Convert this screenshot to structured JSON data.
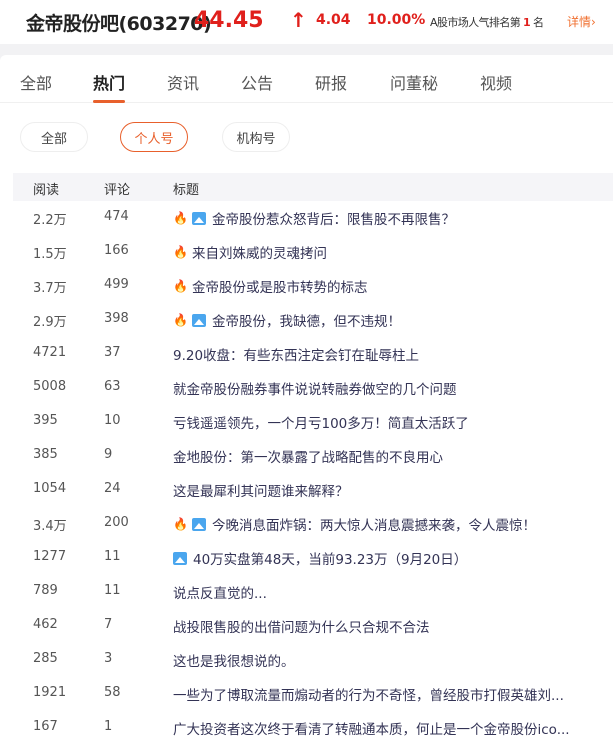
{
  "header": {
    "name": "金帝股份吧(603270)",
    "price": "44.45",
    "arrow": "↑",
    "change": "4.04",
    "percent": "10.00%",
    "rank_prefix": "A股市场人气排名第",
    "rank": "1",
    "rank_suffix": "名",
    "detail": "详情›"
  },
  "tabs": [
    "全部",
    "热门",
    "资讯",
    "公告",
    "研报",
    "问董秘",
    "视频"
  ],
  "filters": [
    "全部",
    "个人号",
    "机构号"
  ],
  "columns": [
    "阅读",
    "评论",
    "标题"
  ],
  "rows": [
    {
      "read": "2.2万",
      "comments": "474",
      "hot": true,
      "img": true,
      "title": "金帝股份惹众怒背后：限售股不再限售？"
    },
    {
      "read": "1.5万",
      "comments": "166",
      "hot": true,
      "img": false,
      "title": "来自刘姝威的灵魂拷问"
    },
    {
      "read": "3.7万",
      "comments": "499",
      "hot": true,
      "img": false,
      "title": "金帝股份或是股市转势的标志"
    },
    {
      "read": "2.9万",
      "comments": "398",
      "hot": true,
      "img": true,
      "title": "金帝股份，我缺德，但不违规！"
    },
    {
      "read": "4721",
      "comments": "37",
      "hot": false,
      "img": false,
      "title": "9.20收盘：有些东西注定会钉在耻辱柱上"
    },
    {
      "read": "5008",
      "comments": "63",
      "hot": false,
      "img": false,
      "title": "就金帝股份融券事件说说转融券做空的几个问题"
    },
    {
      "read": "395",
      "comments": "10",
      "hot": false,
      "img": false,
      "title": "亏钱遥遥领先，一个月亏100多万！简直太活跃了"
    },
    {
      "read": "385",
      "comments": "9",
      "hot": false,
      "img": false,
      "title": "金地股份：第一次暴露了战略配售的不良用心"
    },
    {
      "read": "1054",
      "comments": "24",
      "hot": false,
      "img": false,
      "title": "这是最犀利其问题谁来解释？"
    },
    {
      "read": "3.4万",
      "comments": "200",
      "hot": true,
      "img": true,
      "title": "今晚消息面炸锅：两大惊人消息震撼来袭，令人震惊！"
    },
    {
      "read": "1277",
      "comments": "11",
      "hot": false,
      "img": true,
      "title": "40万实盘第48天，当前93.23万（9月20日）"
    },
    {
      "read": "789",
      "comments": "11",
      "hot": false,
      "img": false,
      "title": "说点反直觉的..."
    },
    {
      "read": "462",
      "comments": "7",
      "hot": false,
      "img": false,
      "title": "战投限售股的出借问题为什么只合规不合法"
    },
    {
      "read": "285",
      "comments": "3",
      "hot": false,
      "img": false,
      "title": "这也是我很想说的。"
    },
    {
      "read": "1921",
      "comments": "58",
      "hot": false,
      "img": false,
      "title": "一些为了博取流量而煽动者的行为不奇怪，曾经股市打假英雄刘..."
    },
    {
      "read": "167",
      "comments": "1",
      "hot": false,
      "img": false,
      "title": "广大投资者这次终于看清了转融通本质，何止是一个金帝股份ico..."
    }
  ]
}
